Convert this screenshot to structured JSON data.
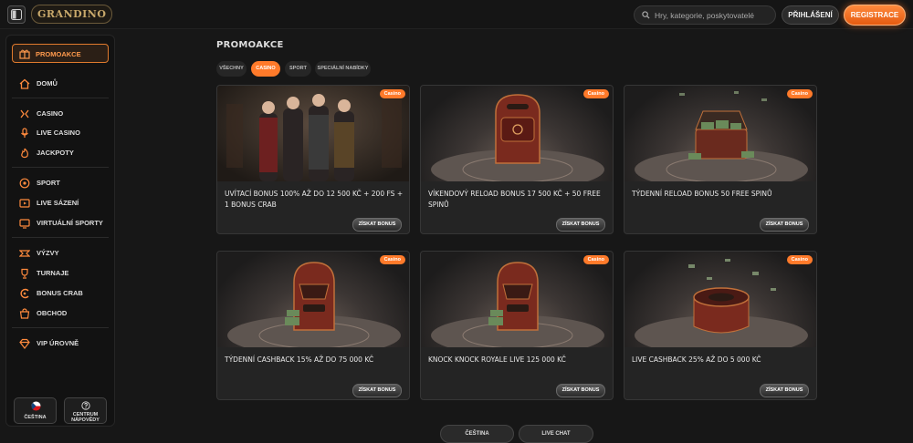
{
  "header": {
    "logo_text": "GRANDINO",
    "search_placeholder": "Hry, kategorie, poskytovatelé",
    "login_label": "PŘIHLÁŠENÍ",
    "register_label": "REGISTRACE"
  },
  "sidebar": {
    "active": {
      "label": "PROMOAKCE",
      "icon": "gift-icon"
    },
    "groups": [
      [
        {
          "label": "DOMŮ",
          "icon": "home-icon"
        }
      ],
      [
        {
          "label": "CASINO",
          "icon": "casino-icon"
        },
        {
          "label": "LIVE CASINO",
          "icon": "live-casino-icon"
        },
        {
          "label": "JACKPOTY",
          "icon": "jackpot-icon"
        }
      ],
      [
        {
          "label": "SPORT",
          "icon": "ball-icon"
        },
        {
          "label": "LIVE SÁZENÍ",
          "icon": "live-bet-icon"
        },
        {
          "label": "VIRTUÁLNÍ SPORTY",
          "icon": "virtual-sport-icon"
        }
      ],
      [
        {
          "label": "VÝZVY",
          "icon": "challenge-icon"
        },
        {
          "label": "TURNAJE",
          "icon": "trophy-icon"
        },
        {
          "label": "BONUS CRAB",
          "icon": "crab-icon"
        },
        {
          "label": "OBCHOD",
          "icon": "shop-icon"
        }
      ],
      [
        {
          "label": "VIP ÚROVNĚ",
          "icon": "diamond-icon"
        }
      ]
    ],
    "language_label": "ČEŠTINA",
    "help_label_1": "CENTRUM",
    "help_label_2": "NÁPOVĚDY"
  },
  "main": {
    "title": "PROMOAKCE",
    "tabs": [
      "VŠECHNY",
      "CASINO",
      "SPORT",
      "SPECIÁLNÍ NABÍDKY"
    ],
    "active_tab": "CASINO",
    "cards": [
      {
        "badge": "Casino",
        "title": "UVÍTACÍ BONUS 100% AŽ DO 12 500 KČ + 200 FS + 1 BONUS CRAB",
        "cta": "ZÍSKAT BONUS",
        "art": "characters"
      },
      {
        "badge": "Casino",
        "title": "VÍKENDOVÝ RELOAD BONUS 17 500 KČ + 50 FREE SPINŮ",
        "cta": "ZÍSKAT BONUS",
        "art": "premium-box"
      },
      {
        "badge": "Casino",
        "title": "TÝDENNÍ RELOAD BONUS 50 FREE SPINŮ",
        "cta": "ZÍSKAT BONUS",
        "art": "money-chest"
      },
      {
        "badge": "Casino",
        "title": "TÝDENNÍ CASHBACK 15% AŽ DO 75 000 KČ",
        "cta": "ZÍSKAT BONUS",
        "art": "cash-machine"
      },
      {
        "badge": "Casino",
        "title": "KNOCK KNOCK ROYALE LIVE 125 000 KČ",
        "cta": "ZÍSKAT BONUS",
        "art": "cash-machine"
      },
      {
        "badge": "Casino",
        "title": "LIVE CASHBACK 25% AŽ DO 5 000 KČ",
        "cta": "ZÍSKAT BONUS",
        "art": "roulette"
      }
    ]
  },
  "footer": {
    "buttons": [
      "ČEŠTINA",
      "LIVE CHAT"
    ]
  },
  "colors": {
    "accent": "#ff7a2a",
    "background": "#171717",
    "card": "#242424"
  }
}
